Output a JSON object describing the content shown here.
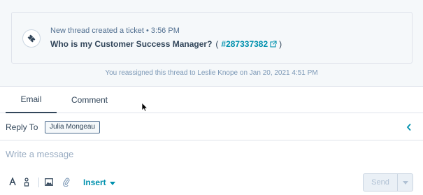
{
  "thread": {
    "event_text": "New thread created a ticket",
    "separator": "•",
    "time": "3:56 PM",
    "subject": "Who is my Customer Success Manager?",
    "open_paren": "(",
    "ticket_id": "#287337382",
    "close_paren": ")"
  },
  "reassign_note": "You reassigned this thread to Leslie Knope on Jan 20, 2021 4:51 PM",
  "composer": {
    "tabs": [
      {
        "label": "Email",
        "active": true
      },
      {
        "label": "Comment",
        "active": false
      }
    ],
    "reply_to_label": "Reply To",
    "recipient": "Julia Mongeau",
    "message_placeholder": "Write a message",
    "toolbar": {
      "insert_label": "Insert",
      "send_label": "Send"
    }
  },
  "icons": {
    "ticket": "ticket-icon",
    "external_link": "external-link-icon",
    "collapse": "chevron-left-icon",
    "font": "font-style-icon",
    "personalize": "personalize-icon",
    "image": "image-icon",
    "attach": "paperclip-icon",
    "caret": "caret-down-icon"
  },
  "colors": {
    "link": "#0091ae",
    "text": "#33475b",
    "muted": "#7c98b6",
    "border": "#dfe3eb"
  }
}
